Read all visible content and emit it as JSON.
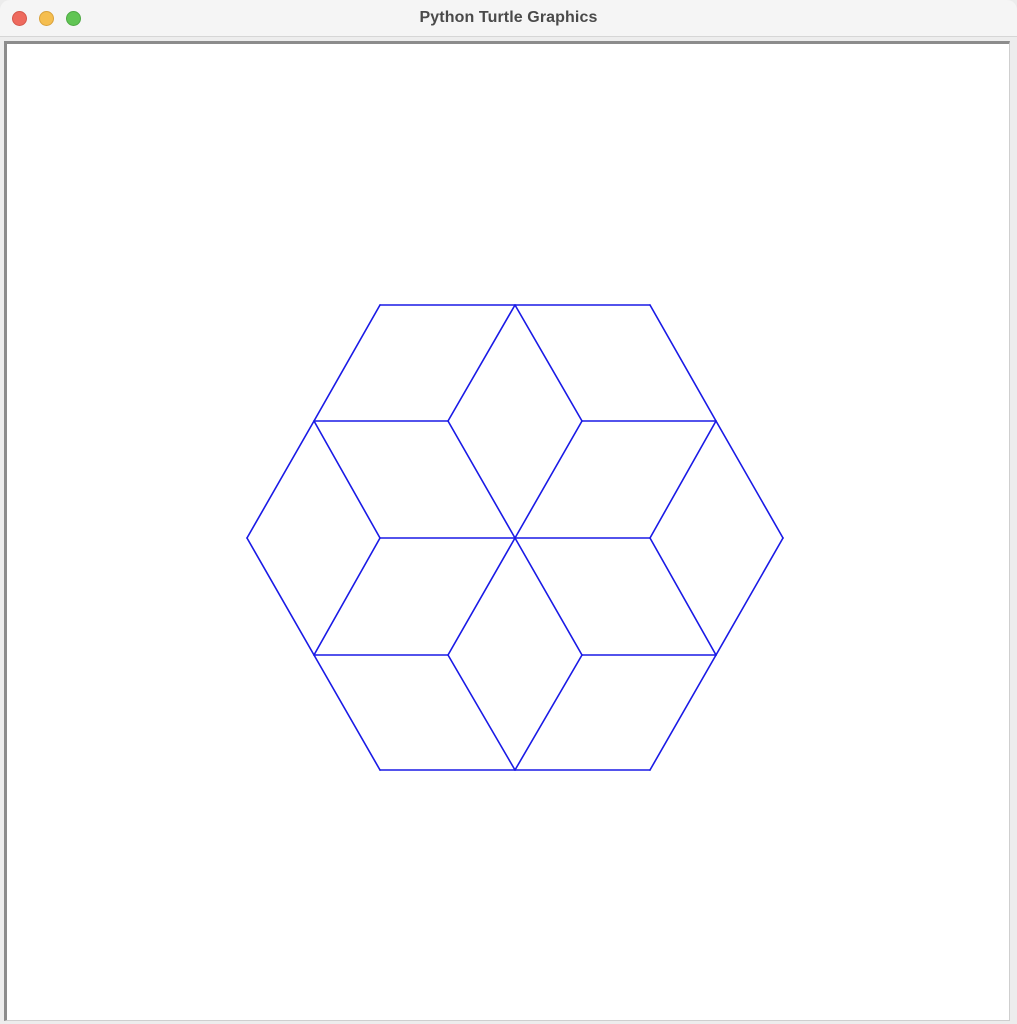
{
  "window": {
    "title": "Python Turtle Graphics"
  },
  "colors": {
    "stroke": "#1a1ae6",
    "canvas_background": "#ffffff",
    "titlebar_background": "#f5f5f5"
  },
  "drawing": {
    "shape": "hexagon tiled with rhombi (tumbling blocks star)",
    "pen_color_name": "blue"
  }
}
